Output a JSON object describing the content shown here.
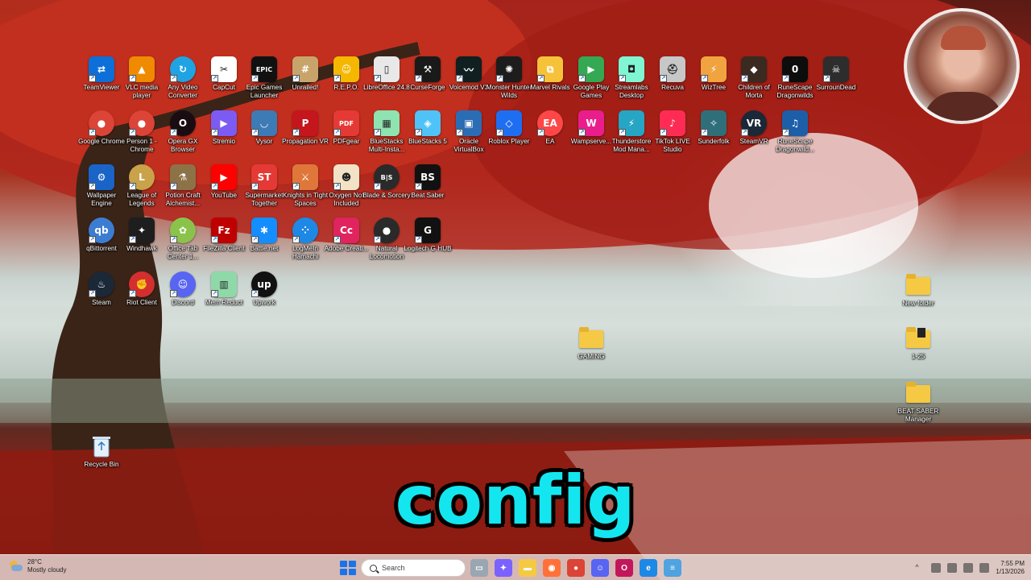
{
  "desktop": {
    "rows": [
      [
        {
          "label": "TeamViewer",
          "icon": "teamviewer-icon",
          "color": "#0e6fd8",
          "glyph": "⇄",
          "round": false
        },
        {
          "label": "VLC media player",
          "icon": "vlc-icon",
          "color": "#f08a00",
          "glyph": "▲",
          "round": false
        },
        {
          "label": "Any Video Converter",
          "icon": "any-video-converter-icon",
          "color": "#1fa3e3",
          "glyph": "↻",
          "round": true
        },
        {
          "label": "CapCut",
          "icon": "capcut-icon",
          "color": "#ffffff",
          "glyph": "✂",
          "round": false
        },
        {
          "label": "Epic Games Launcher",
          "icon": "epic-games-icon",
          "color": "#111111",
          "glyph": "EPIC",
          "round": false
        },
        {
          "label": "Unrailed!",
          "icon": "unrailed-icon",
          "color": "#c9a46a",
          "glyph": "#",
          "round": false
        },
        {
          "label": "R.E.P.O.",
          "icon": "repo-icon",
          "color": "#f5b800",
          "glyph": "☺",
          "round": false
        },
        {
          "label": "LibreOffice 24.8",
          "icon": "libreoffice-icon",
          "color": "#e8e8e8",
          "glyph": "▯",
          "round": false
        },
        {
          "label": "CurseForge",
          "icon": "curseforge-icon",
          "color": "#1a1a1a",
          "glyph": "⚒",
          "round": false
        },
        {
          "label": "Voicemod V3",
          "icon": "voicemod-icon",
          "color": "#102020",
          "glyph": "〰",
          "round": false
        },
        {
          "label": "Monster Hunter Wilds",
          "icon": "monster-hunter-icon",
          "color": "#1d1d1d",
          "glyph": "✺",
          "round": false
        },
        {
          "label": "Marvel Rivals",
          "icon": "marvel-rivals-icon",
          "color": "#f6c23a",
          "glyph": "⧉",
          "round": false
        },
        {
          "label": "Google Play Games",
          "icon": "google-play-games-icon",
          "color": "#34a853",
          "glyph": "▶",
          "round": false
        },
        {
          "label": "Streamlabs Desktop",
          "icon": "streamlabs-icon",
          "color": "#80f5d2",
          "glyph": "◘",
          "round": false
        },
        {
          "label": "Recuva",
          "icon": "recuva-icon",
          "color": "#c7c7c7",
          "glyph": "⛑",
          "round": false
        },
        {
          "label": "WizTree",
          "icon": "wiztree-icon",
          "color": "#f1a340",
          "glyph": "⚡",
          "round": false
        },
        {
          "label": "Children of Morta",
          "icon": "children-of-morta-icon",
          "color": "#3a2a20",
          "glyph": "◆",
          "round": false
        },
        {
          "label": "RuneScape Dragonwilds",
          "icon": "runescape-dragonwilds-icon",
          "color": "#0d0d0d",
          "glyph": "0",
          "round": false
        },
        {
          "label": "SurrounDead",
          "icon": "surrounddead-icon",
          "color": "#2d2d2d",
          "glyph": "☠",
          "round": false
        }
      ],
      [
        {
          "label": "Google Chrome",
          "icon": "chrome-icon",
          "color": "#db4437",
          "glyph": "●",
          "round": true
        },
        {
          "label": "Person 1 - Chrome",
          "icon": "chrome-profile-icon",
          "color": "#db4437",
          "glyph": "●",
          "round": true
        },
        {
          "label": "Opera GX Browser",
          "icon": "opera-gx-icon",
          "color": "#1a0d12",
          "glyph": "O",
          "round": true
        },
        {
          "label": "Stremio",
          "icon": "stremio-icon",
          "color": "#7b5bf2",
          "glyph": "▶",
          "round": false
        },
        {
          "label": "Vysor",
          "icon": "vysor-icon",
          "color": "#3c7bb5",
          "glyph": "◡",
          "round": false
        },
        {
          "label": "Propagation VR",
          "icon": "propagation-vr-icon",
          "color": "#c4161c",
          "glyph": "P",
          "round": false
        },
        {
          "label": "PDFgear",
          "icon": "pdfgear-icon",
          "color": "#e53935",
          "glyph": "PDF",
          "round": false
        },
        {
          "label": "BlueStacks Multi-Insta...",
          "icon": "bluestacks-multi-icon",
          "color": "#8fe3b0",
          "glyph": "▦",
          "round": false
        },
        {
          "label": "BlueStacks 5",
          "icon": "bluestacks-icon",
          "color": "#4fc3f7",
          "glyph": "◈",
          "round": false
        },
        {
          "label": "Oracle VirtualBox",
          "icon": "virtualbox-icon",
          "color": "#2b6db5",
          "glyph": "▣",
          "round": false
        },
        {
          "label": "Roblox Player",
          "icon": "roblox-icon",
          "color": "#1e6ef2",
          "glyph": "◇",
          "round": false
        },
        {
          "label": "EA",
          "icon": "ea-icon",
          "color": "#ff4747",
          "glyph": "EA",
          "round": true
        },
        {
          "label": "Wampserve...",
          "icon": "wampserver-icon",
          "color": "#e91e8c",
          "glyph": "W",
          "round": false
        },
        {
          "label": "Thunderstore Mod Mana...",
          "icon": "thunderstore-icon",
          "color": "#26a5c4",
          "glyph": "⚡",
          "round": false
        },
        {
          "label": "TikTok LIVE Studio",
          "icon": "tiktok-live-icon",
          "color": "#fe2c55",
          "glyph": "♪",
          "round": false
        },
        {
          "label": "Sunderfolk",
          "icon": "sunderfolk-icon",
          "color": "#2f6f7a",
          "glyph": "✧",
          "round": false
        },
        {
          "label": "SteamVR",
          "icon": "steamvr-icon",
          "color": "#1b2838",
          "glyph": "VR",
          "round": true
        },
        {
          "label": "RuneScape Dragonwild...",
          "icon": "runescape-dragonwilds-music-icon",
          "color": "#1c5fa8",
          "glyph": "♫",
          "round": false
        }
      ],
      [
        {
          "label": "Wallpaper Engine",
          "icon": "wallpaper-engine-icon",
          "color": "#1a64c8",
          "glyph": "⚙",
          "round": false
        },
        {
          "label": "League of Legends",
          "icon": "league-of-legends-icon",
          "color": "#c9a24a",
          "glyph": "L",
          "round": true
        },
        {
          "label": "Potion Craft Alchemist...",
          "icon": "potion-craft-icon",
          "color": "#8d7248",
          "glyph": "⚗",
          "round": false
        },
        {
          "label": "YouTube",
          "icon": "youtube-icon",
          "color": "#ff0000",
          "glyph": "▶",
          "round": false
        },
        {
          "label": "Supermarket Together",
          "icon": "supermarket-together-icon",
          "color": "#e53935",
          "glyph": "ST",
          "round": false
        },
        {
          "label": "Knights in Tight Spaces",
          "icon": "knights-tight-spaces-icon",
          "color": "#e0773a",
          "glyph": "⚔",
          "round": false
        },
        {
          "label": "Oxygen Not Included",
          "icon": "oxygen-not-included-icon",
          "color": "#f2e3c6",
          "glyph": "☻",
          "round": false
        },
        {
          "label": "Blade & Sorcery",
          "icon": "blade-sorcery-icon",
          "color": "#2a2a2a",
          "glyph": "B|S",
          "round": true
        },
        {
          "label": "Beat Saber",
          "icon": "beat-saber-icon",
          "color": "#111111",
          "glyph": "BS",
          "round": false
        }
      ],
      [
        {
          "label": "qBittorrent",
          "icon": "qbittorrent-icon",
          "color": "#3c7dd1",
          "glyph": "qb",
          "round": true
        },
        {
          "label": "Windhawk",
          "icon": "windhawk-icon",
          "color": "#1e1e1e",
          "glyph": "✦",
          "round": false
        },
        {
          "label": "Office Tab Center 1...",
          "icon": "office-tab-icon",
          "color": "#8bc34a",
          "glyph": "✿",
          "round": true
        },
        {
          "label": "FileZilla Client",
          "icon": "filezilla-icon",
          "color": "#bf0000",
          "glyph": "Fz",
          "round": false
        },
        {
          "label": "Battle.net",
          "icon": "battlenet-icon",
          "color": "#148eff",
          "glyph": "✱",
          "round": false
        },
        {
          "label": "LogMeIn Hamachi",
          "icon": "hamachi-icon",
          "color": "#1e88e5",
          "glyph": "⁘",
          "round": true
        },
        {
          "label": "Adobe Creati...",
          "icon": "adobe-cc-icon",
          "color": "#e0245e",
          "glyph": "Cc",
          "round": false
        },
        {
          "label": "Natural Locomotion",
          "icon": "natural-locomotion-icon",
          "color": "#2a2a2a",
          "glyph": "●",
          "round": true
        },
        {
          "label": "Logitech G HUB",
          "icon": "logitech-ghub-icon",
          "color": "#111111",
          "glyph": "G",
          "round": false
        }
      ],
      [
        {
          "label": "Steam",
          "icon": "steam-icon",
          "color": "#1b2838",
          "glyph": "♨",
          "round": true
        },
        {
          "label": "Riot Client",
          "icon": "riot-client-icon",
          "color": "#d32f2f",
          "glyph": "✊",
          "round": true
        },
        {
          "label": "Discord",
          "icon": "discord-icon",
          "color": "#5865f2",
          "glyph": "☺",
          "round": true
        },
        {
          "label": "Mem Reduct",
          "icon": "mem-reduct-icon",
          "color": "#8fd9a8",
          "glyph": "▥",
          "round": false
        },
        {
          "label": "Upwork",
          "icon": "upwork-icon",
          "color": "#111111",
          "glyph": "up",
          "round": true
        }
      ]
    ],
    "recycle_bin": {
      "label": "Recycle Bin",
      "icon": "recycle-bin-icon"
    },
    "folders": [
      {
        "label": "GAMING",
        "icon": "folder-icon",
        "shortcut": false
      },
      {
        "label": "New folder",
        "icon": "folder-icon",
        "shortcut": false
      },
      {
        "label": "1-25",
        "icon": "folder-icon",
        "shortcut": true
      },
      {
        "label": "BEAT SABER Manager",
        "icon": "folder-icon",
        "shortcut": false
      }
    ]
  },
  "caption": {
    "text": "config"
  },
  "taskbar": {
    "weather": {
      "temperature": "28°C",
      "condition": "Mostly cloudy",
      "icon": "partly-cloudy-icon"
    },
    "search_placeholder": "Search",
    "pinned": [
      {
        "icon": "task-view-icon",
        "color": "#9aa6b2",
        "glyph": "▭"
      },
      {
        "icon": "copilot-icon",
        "color": "#7b61ff",
        "glyph": "✦"
      },
      {
        "icon": "file-explorer-icon",
        "color": "#f5c944",
        "glyph": "▬"
      },
      {
        "icon": "firefox-icon",
        "color": "#ff7139",
        "glyph": "◉"
      },
      {
        "icon": "chrome-icon",
        "color": "#db4437",
        "glyph": "●"
      },
      {
        "icon": "discord-icon",
        "color": "#5865f2",
        "glyph": "☺"
      },
      {
        "icon": "opera-gx-icon",
        "color": "#c2185b",
        "glyph": "O"
      },
      {
        "icon": "edge-icon",
        "color": "#1e88e5",
        "glyph": "e"
      },
      {
        "icon": "notepad-icon",
        "color": "#4fa3e0",
        "glyph": "≡"
      }
    ],
    "clock": {
      "time": "7:55 PM",
      "date": "1/13/2026"
    }
  }
}
